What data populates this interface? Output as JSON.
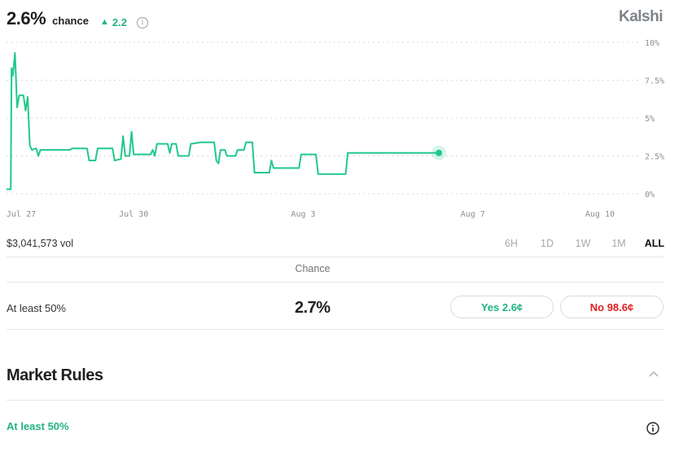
{
  "header": {
    "chance_value": "2.6%",
    "chance_word": "chance",
    "delta_arrow": "▲",
    "delta_value": "2.2",
    "info_glyph": "i",
    "brand": "Kalshi"
  },
  "chart_data": {
    "type": "line",
    "series": [
      {
        "values": [
          {
            "x": 0,
            "y": 0.3
          },
          {
            "x": 0.1,
            "y": 0.3
          },
          {
            "x": 0.12,
            "y": 8.3
          },
          {
            "x": 0.15,
            "y": 7.8
          },
          {
            "x": 0.2,
            "y": 9.3
          },
          {
            "x": 0.25,
            "y": 5.7
          },
          {
            "x": 0.3,
            "y": 6.5
          },
          {
            "x": 0.4,
            "y": 6.5
          },
          {
            "x": 0.45,
            "y": 5.5
          },
          {
            "x": 0.5,
            "y": 6.4
          },
          {
            "x": 0.55,
            "y": 3.2
          },
          {
            "x": 0.6,
            "y": 2.9
          },
          {
            "x": 0.7,
            "y": 3.0
          },
          {
            "x": 0.75,
            "y": 2.5
          },
          {
            "x": 0.8,
            "y": 2.9
          },
          {
            "x": 1.0,
            "y": 2.9
          },
          {
            "x": 1.5,
            "y": 2.9
          },
          {
            "x": 1.55,
            "y": 3.0
          },
          {
            "x": 1.9,
            "y": 3.0
          },
          {
            "x": 1.95,
            "y": 2.2
          },
          {
            "x": 2.1,
            "y": 2.2
          },
          {
            "x": 2.15,
            "y": 3.0
          },
          {
            "x": 2.5,
            "y": 3.0
          },
          {
            "x": 2.55,
            "y": 2.2
          },
          {
            "x": 2.7,
            "y": 2.3
          },
          {
            "x": 2.75,
            "y": 3.8
          },
          {
            "x": 2.8,
            "y": 2.5
          },
          {
            "x": 2.9,
            "y": 2.5
          },
          {
            "x": 2.95,
            "y": 4.1
          },
          {
            "x": 3.0,
            "y": 2.6
          },
          {
            "x": 3.4,
            "y": 2.6
          },
          {
            "x": 3.45,
            "y": 2.9
          },
          {
            "x": 3.5,
            "y": 2.5
          },
          {
            "x": 3.55,
            "y": 3.3
          },
          {
            "x": 3.8,
            "y": 3.3
          },
          {
            "x": 3.85,
            "y": 2.7
          },
          {
            "x": 3.9,
            "y": 3.3
          },
          {
            "x": 4.0,
            "y": 3.3
          },
          {
            "x": 4.05,
            "y": 2.5
          },
          {
            "x": 4.3,
            "y": 2.5
          },
          {
            "x": 4.35,
            "y": 3.3
          },
          {
            "x": 4.6,
            "y": 3.4
          },
          {
            "x": 4.9,
            "y": 3.4
          },
          {
            "x": 4.95,
            "y": 2.2
          },
          {
            "x": 5.0,
            "y": 2.0
          },
          {
            "x": 5.05,
            "y": 2.9
          },
          {
            "x": 5.15,
            "y": 2.9
          },
          {
            "x": 5.2,
            "y": 2.5
          },
          {
            "x": 5.4,
            "y": 2.5
          },
          {
            "x": 5.45,
            "y": 2.9
          },
          {
            "x": 5.6,
            "y": 2.9
          },
          {
            "x": 5.65,
            "y": 3.4
          },
          {
            "x": 5.8,
            "y": 3.4
          },
          {
            "x": 5.85,
            "y": 1.4
          },
          {
            "x": 6.2,
            "y": 1.4
          },
          {
            "x": 6.25,
            "y": 2.2
          },
          {
            "x": 6.3,
            "y": 1.7
          },
          {
            "x": 6.9,
            "y": 1.7
          },
          {
            "x": 6.95,
            "y": 2.6
          },
          {
            "x": 7.3,
            "y": 2.6
          },
          {
            "x": 7.35,
            "y": 1.3
          },
          {
            "x": 8.0,
            "y": 1.3
          },
          {
            "x": 8.05,
            "y": 2.7
          },
          {
            "x": 10.2,
            "y": 2.7
          }
        ]
      }
    ],
    "x_ticks": [
      {
        "x": 0,
        "label": "Jul 27"
      },
      {
        "x": 3,
        "label": "Jul 30"
      },
      {
        "x": 7,
        "label": "Aug 3"
      },
      {
        "x": 11,
        "label": "Aug 7"
      },
      {
        "x": 14,
        "label": "Aug 10"
      }
    ],
    "y_ticks": [
      {
        "y": 10,
        "label": "10%"
      },
      {
        "y": 7.5,
        "label": "7.5%"
      },
      {
        "y": 5,
        "label": "5%"
      },
      {
        "y": 2.5,
        "label": "2.5%"
      },
      {
        "y": 0,
        "label": "0%"
      }
    ],
    "ylim": [
      0,
      10
    ],
    "grid": true,
    "color": "#21c98a"
  },
  "volume": "$3,041,573 vol",
  "ranges": [
    "6H",
    "1D",
    "1W",
    "1M",
    "ALL"
  ],
  "active_range": "ALL",
  "table_header": "Chance",
  "outcome": {
    "name": "At least 50%",
    "chance": "2.7%",
    "yes_label": "Yes 2.6¢",
    "no_label": "No 98.6¢"
  },
  "rules": {
    "title": "Market Rules",
    "item_label": "At least 50%"
  },
  "icons": {
    "header_info": "info-circle-icon",
    "collapse": "chevron-up-icon",
    "rule_info": "info-circle-icon"
  }
}
